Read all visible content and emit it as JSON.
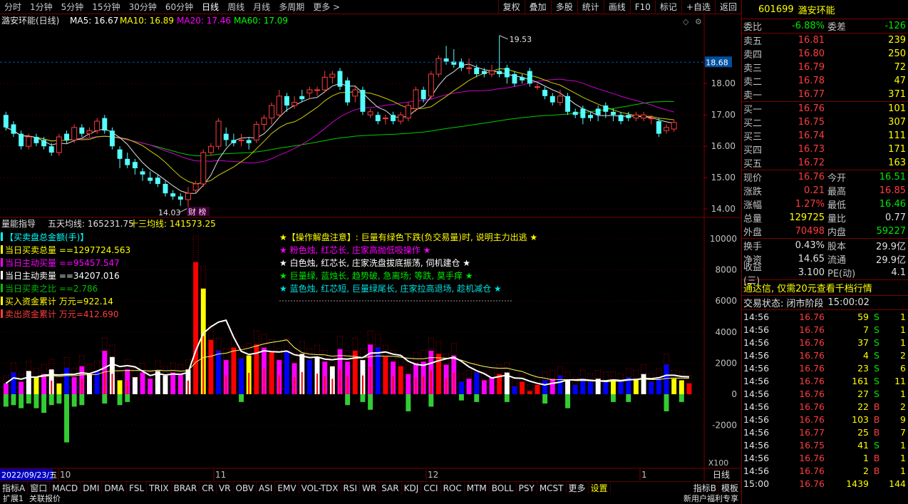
{
  "toolbar": {
    "periods": [
      "分时",
      "1分钟",
      "5分钟",
      "15分钟",
      "30分钟",
      "60分钟",
      "日线",
      "周线",
      "月线",
      "多周期",
      "更多 >"
    ],
    "active_period": "日线",
    "right_buttons": [
      "复权",
      "叠加",
      "多股",
      "统计",
      "画线",
      "F10",
      "标记",
      "+自选",
      "返回"
    ]
  },
  "main_chart": {
    "title": "潞安环能(日线)",
    "ma_labels": [
      {
        "text": "MA5: 16.67",
        "color": "#ffffff"
      },
      {
        "text": "MA10: 16.89",
        "color": "#ffff00"
      },
      {
        "text": "MA20: 17.46",
        "color": "#ff00ff"
      },
      {
        "text": "MA60: 17.09",
        "color": "#00ff00"
      }
    ],
    "price_ticks": [
      "18.00",
      "17.00",
      "16.00",
      "15.00",
      "14.00"
    ],
    "current_price_tag": "18.68",
    "high_marker": "19.53",
    "low_marker": "14.03",
    "event_marker": "财 榜"
  },
  "volume_chart": {
    "title_parts": [
      {
        "text": "量能指导",
        "color": "#e0e0e0"
      },
      {
        "text": "五天均线: 165231.75",
        "color": "#e0e0e0"
      },
      {
        "text": "十三均线: 141573.25",
        "color": "#ffff00"
      }
    ],
    "legend": [
      {
        "text": "【买卖盘总金额(手)】",
        "color": "#00ffff"
      },
      {
        "text": "当日买卖总量 ==1297724.563",
        "color": "#ffff00"
      },
      {
        "text": "当日主动买量 ==95457.547",
        "color": "#ff00ff"
      },
      {
        "text": "当日主动卖量 ==34207.016",
        "color": "#ffffff"
      },
      {
        "text": "当日买卖之比 ==2.786",
        "color": "#00c000"
      },
      {
        "text": "买入资金累计 万元=922.14",
        "color": "#ffff00"
      },
      {
        "text": "卖出资金累计 万元=412.690",
        "color": "#ff3c3c"
      }
    ],
    "notes": [
      {
        "text": "★【操作解盘注意】: 巨量有绿色下跌(负交易量)时, 说明主力出逃 ★",
        "color": "#ffff00"
      },
      {
        "text": "★ 粉色烛, 红芯长, 庄家高抛低吸操作 ★",
        "color": "#ff00ff"
      },
      {
        "text": "★ 白色烛, 红芯长, 庄家洗盘拔底振荡, 伺机建仓 ★",
        "color": "#ffffff"
      },
      {
        "text": "★ 巨量绿, 蓝烛长, 趋势破, 急离场; 等跌, 莫手痒 ★",
        "color": "#00e600"
      },
      {
        "text": "★ 蓝色烛, 红芯短, 巨量绿尾长, 庄家拉高退场, 趁机减仓 ★",
        "color": "#00e0e0"
      }
    ],
    "vol_ticks": [
      "10000",
      "8000",
      "6000",
      "4000",
      "2000",
      "0",
      "-2000"
    ],
    "unit_label": "X100"
  },
  "date_axis": {
    "start_date": "2022/09/23/五",
    "months": [
      "10",
      "11",
      "12",
      "1"
    ],
    "right_label": "日线"
  },
  "indicator_tabs": [
    "指标A",
    "窗口",
    "MACD",
    "DMI",
    "DMA",
    "FSL",
    "TRIX",
    "BRAR",
    "CR",
    "VR",
    "OBV",
    "ASI",
    "EMV",
    "VOL-TDX",
    "RSI",
    "WR",
    "SAR",
    "KDJ",
    "CCI",
    "ROC",
    "MTM",
    "BOLL",
    "PSY",
    "MCST",
    "更多",
    "设置"
  ],
  "active_indicator_tab": "设置",
  "indicator_right": [
    "指标B",
    "模板"
  ],
  "status_bar": [
    "扩展1",
    "关联报价",
    "新用户福利专享"
  ],
  "quote": {
    "code": "601699",
    "name": "潞安环能",
    "weibi_label": "委比",
    "weibi": "-6.88%",
    "weicha_label": "委差",
    "weicha": "-126",
    "asks": [
      {
        "label": "卖五",
        "price": "16.81",
        "vol": "239"
      },
      {
        "label": "卖四",
        "price": "16.80",
        "vol": "250"
      },
      {
        "label": "卖三",
        "price": "16.79",
        "vol": "72"
      },
      {
        "label": "卖二",
        "price": "16.78",
        "vol": "47"
      },
      {
        "label": "卖一",
        "price": "16.77",
        "vol": "371"
      }
    ],
    "bids": [
      {
        "label": "买一",
        "price": "16.76",
        "vol": "101"
      },
      {
        "label": "买二",
        "price": "16.75",
        "vol": "307"
      },
      {
        "label": "买三",
        "price": "16.74",
        "vol": "111"
      },
      {
        "label": "买四",
        "price": "16.73",
        "vol": "171"
      },
      {
        "label": "买五",
        "price": "16.72",
        "vol": "163"
      }
    ],
    "stats": [
      {
        "l1": "现价",
        "v1": "16.76",
        "c1": "red",
        "l2": "今开",
        "v2": "16.51",
        "c2": "green"
      },
      {
        "l1": "涨跌",
        "v1": "0.21",
        "c1": "red",
        "l2": "最高",
        "v2": "16.85",
        "c2": "red"
      },
      {
        "l1": "涨幅",
        "v1": "1.27%",
        "c1": "red",
        "l2": "最低",
        "v2": "16.46",
        "c2": "green"
      },
      {
        "l1": "总量",
        "v1": "129725",
        "c1": "yellow",
        "l2": "量比",
        "v2": "0.77",
        "c2": "white"
      },
      {
        "l1": "外盘",
        "v1": "70498",
        "c1": "red",
        "l2": "内盘",
        "v2": "59227",
        "c2": "green"
      }
    ],
    "stats2": [
      {
        "l1": "换手",
        "v1": "0.43%",
        "l2": "股本",
        "v2": "29.9亿"
      },
      {
        "l1": "净资",
        "v1": "14.65",
        "l2": "流通",
        "v2": "29.9亿"
      },
      {
        "l1": "收益(三)",
        "v1": "3.100",
        "l2": "PE(动)",
        "v2": "4.1"
      }
    ],
    "banner": "通达信, 仅需20元查看千档行情",
    "trade_status_label": "交易状态: 闭市阶段",
    "trade_status_time": "15:00:02"
  },
  "ticks": [
    {
      "t": "14:56",
      "p": "16.76",
      "q": "59",
      "s": "S",
      "n": "1"
    },
    {
      "t": "14:56",
      "p": "16.76",
      "q": "7",
      "s": "S",
      "n": "1"
    },
    {
      "t": "14:56",
      "p": "16.76",
      "q": "37",
      "s": "S",
      "n": "1"
    },
    {
      "t": "14:56",
      "p": "16.76",
      "q": "4",
      "s": "S",
      "n": "2"
    },
    {
      "t": "14:56",
      "p": "16.76",
      "q": "23",
      "s": "S",
      "n": "6"
    },
    {
      "t": "14:56",
      "p": "16.76",
      "q": "161",
      "s": "S",
      "n": "11"
    },
    {
      "t": "14:56",
      "p": "16.76",
      "q": "27",
      "s": "S",
      "n": "1"
    },
    {
      "t": "14:56",
      "p": "16.76",
      "q": "22",
      "s": "B",
      "n": "2"
    },
    {
      "t": "14:56",
      "p": "16.76",
      "q": "103",
      "s": "B",
      "n": "9"
    },
    {
      "t": "14:56",
      "p": "16.77",
      "q": "25",
      "s": "B",
      "n": "7"
    },
    {
      "t": "14:56",
      "p": "16.75",
      "q": "41",
      "s": "S",
      "n": "1"
    },
    {
      "t": "14:56",
      "p": "16.76",
      "q": "1",
      "s": "B",
      "n": "1"
    },
    {
      "t": "14:56",
      "p": "16.76",
      "q": "2",
      "s": "B",
      "n": "1"
    },
    {
      "t": "15:00",
      "p": "16.76",
      "q": "1439",
      "s": "",
      "n": "144"
    }
  ],
  "chart_data": {
    "type": "candlestick",
    "price_range": [
      13.8,
      19.8
    ],
    "candles": [
      [
        17.0,
        16.6,
        17.1,
        16.5
      ],
      [
        16.7,
        16.4,
        16.8,
        16.3
      ],
      [
        16.4,
        16.0,
        16.5,
        15.9
      ],
      [
        16.0,
        16.3,
        16.4,
        15.9
      ],
      [
        16.3,
        16.1,
        16.4,
        16.0
      ],
      [
        16.2,
        16.0,
        16.3,
        15.9
      ],
      [
        16.0,
        15.8,
        16.1,
        15.7
      ],
      [
        15.8,
        16.3,
        16.4,
        15.7
      ],
      [
        16.4,
        16.2,
        16.5,
        16.1
      ],
      [
        16.2,
        16.6,
        16.7,
        16.1
      ],
      [
        16.6,
        16.4,
        16.7,
        16.3
      ],
      [
        16.4,
        16.5,
        16.6,
        16.3
      ],
      [
        16.5,
        16.8,
        16.9,
        16.4
      ],
      [
        16.9,
        16.5,
        17.0,
        16.4
      ],
      [
        16.5,
        16.0,
        16.6,
        15.9
      ],
      [
        15.9,
        15.6,
        16.0,
        15.3
      ],
      [
        15.6,
        15.4,
        15.8,
        15.3
      ],
      [
        15.5,
        15.3,
        15.6,
        15.1
      ],
      [
        15.2,
        15.1,
        15.3,
        14.9
      ],
      [
        15.0,
        14.9,
        15.2,
        14.8
      ],
      [
        15.0,
        14.8,
        15.1,
        14.7
      ],
      [
        14.8,
        14.5,
        14.9,
        14.4
      ],
      [
        14.5,
        14.4,
        14.6,
        14.3
      ],
      [
        14.4,
        14.3,
        14.5,
        14.1
      ],
      [
        14.3,
        14.5,
        14.7,
        14.03
      ],
      [
        14.6,
        14.8,
        14.9,
        14.5
      ],
      [
        14.8,
        15.8,
        15.9,
        14.7
      ],
      [
        15.8,
        16.0,
        16.1,
        15.7
      ],
      [
        16.0,
        16.8,
        16.9,
        15.9
      ],
      [
        16.4,
        16.2,
        16.6,
        16.0
      ],
      [
        16.2,
        16.1,
        16.4,
        16.0
      ],
      [
        16.2,
        16.2,
        16.4,
        16.0
      ],
      [
        16.2,
        16.1,
        16.3,
        15.9
      ],
      [
        16.2,
        16.7,
        16.8,
        16.1
      ],
      [
        16.7,
        16.9,
        17.0,
        16.5
      ],
      [
        16.9,
        17.3,
        17.4,
        16.7
      ],
      [
        17.0,
        17.6,
        17.8,
        16.9
      ],
      [
        17.6,
        17.3,
        17.7,
        17.1
      ],
      [
        17.3,
        17.4,
        17.6,
        17.2
      ],
      [
        17.6,
        17.5,
        17.8,
        17.4
      ],
      [
        17.7,
        17.8,
        17.9,
        17.5
      ],
      [
        17.8,
        17.8,
        17.9,
        17.6
      ],
      [
        17.8,
        18.2,
        18.4,
        17.7
      ],
      [
        18.2,
        18.3,
        18.4,
        18.0
      ],
      [
        18.4,
        17.9,
        18.5,
        17.8
      ],
      [
        18.1,
        17.4,
        18.2,
        17.3
      ],
      [
        17.6,
        17.8,
        17.9,
        17.4
      ],
      [
        17.8,
        17.1,
        17.9,
        17.0
      ],
      [
        17.0,
        17.1,
        17.2,
        16.9
      ],
      [
        17.0,
        16.8,
        17.1,
        16.7
      ],
      [
        16.9,
        16.9,
        17.0,
        16.7
      ],
      [
        17.0,
        16.8,
        17.1,
        16.7
      ],
      [
        16.8,
        17.0,
        17.1,
        16.7
      ],
      [
        16.9,
        17.3,
        17.4,
        16.8
      ],
      [
        17.2,
        17.8,
        17.9,
        17.1
      ],
      [
        17.8,
        17.5,
        17.9,
        17.4
      ],
      [
        17.6,
        18.3,
        18.4,
        17.5
      ],
      [
        18.3,
        18.8,
        18.9,
        18.2
      ],
      [
        18.8,
        18.7,
        19.2,
        18.6
      ],
      [
        18.7,
        18.6,
        19.1,
        18.5
      ],
      [
        18.7,
        18.5,
        18.8,
        18.4
      ],
      [
        18.5,
        18.5,
        18.8,
        18.3
      ],
      [
        18.5,
        18.3,
        18.6,
        18.2
      ],
      [
        18.4,
        18.3,
        18.5,
        18.2
      ],
      [
        18.3,
        18.4,
        18.6,
        18.2
      ],
      [
        18.4,
        18.3,
        19.53,
        18.2
      ],
      [
        18.5,
        18.2,
        18.6,
        18.0
      ],
      [
        18.3,
        18.0,
        18.4,
        17.9
      ],
      [
        18.2,
        18.1,
        18.3,
        18.0
      ],
      [
        18.4,
        18.0,
        18.5,
        17.9
      ],
      [
        17.9,
        17.9,
        18.0,
        17.8
      ],
      [
        17.8,
        17.6,
        17.9,
        17.5
      ],
      [
        17.6,
        17.4,
        17.7,
        17.3
      ],
      [
        17.4,
        17.6,
        17.8,
        17.3
      ],
      [
        17.6,
        17.1,
        17.7,
        17.0
      ],
      [
        17.1,
        17.0,
        17.2,
        16.9
      ],
      [
        17.2,
        16.9,
        17.3,
        16.7
      ],
      [
        17.0,
        16.9,
        17.1,
        16.8
      ],
      [
        17.2,
        17.0,
        17.3,
        16.8
      ],
      [
        17.3,
        17.1,
        17.4,
        16.9
      ],
      [
        17.1,
        17.0,
        17.2,
        16.8
      ],
      [
        17.0,
        16.8,
        17.1,
        16.7
      ],
      [
        17.0,
        16.9,
        17.1,
        16.8
      ],
      [
        16.9,
        17.0,
        17.1,
        16.8
      ],
      [
        16.9,
        17.0,
        17.1,
        16.8
      ],
      [
        16.9,
        16.9,
        17.0,
        16.7
      ],
      [
        16.8,
        16.4,
        16.9,
        16.3
      ],
      [
        16.5,
        16.6,
        16.7,
        16.4
      ],
      [
        16.55,
        16.76,
        16.85,
        16.46
      ]
    ],
    "volume_bars": [
      [
        700,
        "magenta"
      ],
      [
        1400,
        "blue"
      ],
      [
        800,
        "magenta"
      ],
      [
        1500,
        "white"
      ],
      [
        1100,
        "yellow"
      ],
      [
        1300,
        "magenta"
      ],
      [
        1600,
        "white"
      ],
      [
        700,
        "yellow"
      ],
      [
        1700,
        "blue"
      ],
      [
        1100,
        "magenta"
      ],
      [
        1800,
        "magenta"
      ],
      [
        1300,
        "white"
      ],
      [
        1500,
        "blue"
      ],
      [
        2800,
        "magenta"
      ],
      [
        2400,
        "white"
      ],
      [
        900,
        "yellow"
      ],
      [
        1600,
        "magenta"
      ],
      [
        1100,
        "white"
      ],
      [
        1400,
        "magenta"
      ],
      [
        1000,
        "magenta"
      ],
      [
        1500,
        "white"
      ],
      [
        1200,
        "white"
      ],
      [
        1400,
        "magenta"
      ],
      [
        1300,
        "magenta"
      ],
      [
        1600,
        "white"
      ],
      [
        8500,
        "red"
      ],
      [
        6800,
        "yellow"
      ],
      [
        3500,
        "red"
      ],
      [
        2800,
        "blue"
      ],
      [
        2200,
        "magenta"
      ],
      [
        3000,
        "red"
      ],
      [
        2300,
        "blue"
      ],
      [
        2500,
        "yellow"
      ],
      [
        3200,
        "red"
      ],
      [
        3000,
        "magenta"
      ],
      [
        2700,
        "red"
      ],
      [
        2200,
        "magenta"
      ],
      [
        2800,
        "blue"
      ],
      [
        2000,
        "magenta"
      ],
      [
        2600,
        "white"
      ],
      [
        2200,
        "blue"
      ],
      [
        2400,
        "white"
      ],
      [
        2100,
        "magenta"
      ],
      [
        1800,
        "white"
      ],
      [
        2900,
        "magenta"
      ],
      [
        2100,
        "magenta"
      ],
      [
        2800,
        "red"
      ],
      [
        2200,
        "white"
      ],
      [
        3200,
        "magenta"
      ],
      [
        3000,
        "blue"
      ],
      [
        2400,
        "red"
      ],
      [
        2100,
        "magenta"
      ],
      [
        1800,
        "red"
      ],
      [
        1300,
        "magenta"
      ],
      [
        2000,
        "magenta"
      ],
      [
        2100,
        "magenta"
      ],
      [
        2800,
        "magenta"
      ],
      [
        2600,
        "red"
      ],
      [
        1900,
        "magenta"
      ],
      [
        2500,
        "magenta"
      ],
      [
        800,
        "blue"
      ],
      [
        1000,
        "magenta"
      ],
      [
        1400,
        "blue"
      ],
      [
        900,
        "magenta"
      ],
      [
        1100,
        "magenta"
      ],
      [
        1300,
        "red"
      ],
      [
        1400,
        "white"
      ],
      [
        500,
        "blue"
      ],
      [
        800,
        "red"
      ],
      [
        200,
        "red"
      ],
      [
        600,
        "red"
      ],
      [
        900,
        "blue"
      ],
      [
        1000,
        "magenta"
      ],
      [
        1200,
        "blue"
      ],
      [
        900,
        "white"
      ],
      [
        600,
        "blue"
      ],
      [
        1000,
        "blue"
      ],
      [
        800,
        "blue"
      ],
      [
        1000,
        "white"
      ],
      [
        900,
        "blue"
      ],
      [
        900,
        "yellow"
      ],
      [
        800,
        "blue"
      ],
      [
        1100,
        "blue"
      ],
      [
        1000,
        "yellow"
      ],
      [
        1300,
        "white"
      ],
      [
        800,
        "blue"
      ],
      [
        1100,
        "blue"
      ],
      [
        1900,
        "blue"
      ],
      [
        1000,
        "yellow"
      ],
      [
        900,
        "yellow"
      ],
      [
        700,
        "red"
      ]
    ],
    "neg_volume": [
      [
        0,
        -800
      ],
      [
        1,
        -700
      ],
      [
        2,
        -900
      ],
      [
        3,
        -600
      ],
      [
        4,
        -900
      ],
      [
        5,
        -1200
      ],
      [
        6,
        -700
      ],
      [
        7,
        -600
      ],
      [
        8,
        -3100
      ],
      [
        9,
        -800
      ],
      [
        10,
        -700
      ],
      [
        13,
        -600
      ],
      [
        15,
        -700
      ],
      [
        16,
        -500
      ],
      [
        31,
        -500
      ],
      [
        45,
        -700
      ],
      [
        47,
        -500
      ],
      [
        48,
        -1000
      ],
      [
        53,
        -1100
      ],
      [
        56,
        -800
      ],
      [
        60,
        -400
      ],
      [
        62,
        -500
      ],
      [
        66,
        -500
      ],
      [
        71,
        -600
      ],
      [
        74,
        -900
      ],
      [
        80,
        -500
      ],
      [
        82,
        -500
      ],
      [
        87,
        -1100
      ],
      [
        89,
        -500
      ]
    ]
  }
}
